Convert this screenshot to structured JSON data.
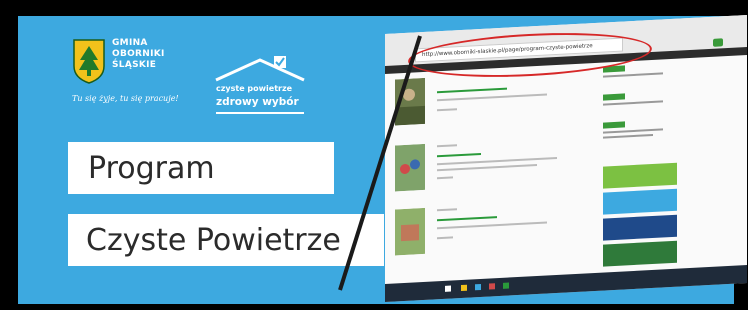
{
  "logo": {
    "gmina_lines": [
      "GMINA",
      "OBORNIKI",
      "ŚLĄSKIE"
    ],
    "motto": "Tu się żyje, tu się pracuje!"
  },
  "cp_logo": {
    "line1": "czyste powietrze",
    "line2": "zdrowy wybór"
  },
  "titles": {
    "line1": "Program",
    "line2": "Czyste Powietrze"
  },
  "browser": {
    "address": "http://www.oborniki-slaskie.pl/page/program-czyste-powietrze"
  },
  "colors": {
    "banner": "#3da9e0",
    "highlight_oval": "#d62828",
    "accent_green": "#3a9a3a"
  }
}
